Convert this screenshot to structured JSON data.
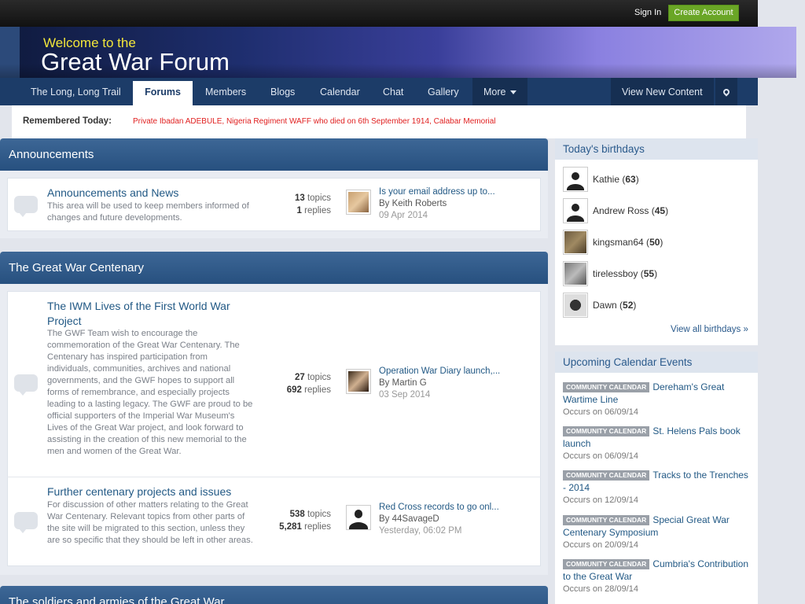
{
  "topbar": {
    "sign_in": "Sign In",
    "create_account": "Create Account"
  },
  "banner": {
    "welcome": "Welcome to the",
    "title": "Great War Forum"
  },
  "nav": {
    "items": [
      "The Long, Long Trail",
      "Forums",
      "Members",
      "Blogs",
      "Calendar",
      "Chat",
      "Gallery",
      "More"
    ],
    "view_new": "View New Content"
  },
  "remembered": {
    "label": "Remembered Today:",
    "message": "Private Ibadan ADEBULE, Nigeria Regiment WAFF who died on 6th September 1914, Calabar Memorial"
  },
  "categories": [
    {
      "title": "Announcements",
      "boards": [
        {
          "name": "Announcements and News",
          "description": "This area will be used to keep members informed of changes and future developments.",
          "topics": "13",
          "topics_label": "topics",
          "replies": "1",
          "replies_label": "replies",
          "last_title": "Is your email address up to...",
          "last_by": "By Keith Roberts",
          "last_date": "09 Apr 2014"
        }
      ]
    },
    {
      "title": "The Great War Centenary",
      "boards": [
        {
          "name": "The IWM Lives of the First World War Project",
          "description": "The GWF Team wish to encourage the commemoration of the Great War Centenary. The Centenary has inspired participation from individuals, communities, archives and national governments, and the GWF hopes to support all forms of remembrance, and especially projects leading to a lasting legacy. The GWF are proud to be official supporters of the Imperial War Museum's Lives of the Great War project, and look forward to assisting in the creation of this new memorial to the men and women of the Great War.",
          "topics": "27",
          "topics_label": "topics",
          "replies": "692",
          "replies_label": "replies",
          "last_title": "Operation War Diary launch,...",
          "last_by": "By Martin G",
          "last_date": "03 Sep 2014"
        },
        {
          "name": "Further centenary projects and issues",
          "description": "For discussion of other matters relating to the Great War Centenary. Relevant topics from other parts of the site will be migrated to this section, unless they are so specific that they should be left in other areas.",
          "topics": "538",
          "topics_label": "topics",
          "replies": "5,281",
          "replies_label": "replies",
          "last_title": "Red Cross records to go onl...",
          "last_by": "By 44SavageD",
          "last_date": "Yesterday, 06:02 PM"
        }
      ]
    },
    {
      "title": "The soldiers and armies of the Great War"
    }
  ],
  "birthdays": {
    "title": "Today's birthdays",
    "people": [
      {
        "name": "Kathie",
        "age": "63"
      },
      {
        "name": "Andrew Ross",
        "age": "45"
      },
      {
        "name": "kingsman64",
        "age": "50"
      },
      {
        "name": "tirelessboy",
        "age": "55"
      },
      {
        "name": "Dawn",
        "age": "52"
      }
    ],
    "view_all": "View all birthdays »"
  },
  "calendar": {
    "title": "Upcoming Calendar Events",
    "tag": "COMMUNITY CALENDAR",
    "events": [
      {
        "title": "Dereham's Great Wartime Line",
        "occurs": "Occurs on 06/09/14"
      },
      {
        "title": "St. Helens Pals book launch",
        "occurs": "Occurs on 06/09/14"
      },
      {
        "title": "Tracks to the Trenches - 2014",
        "occurs": "Occurs on 12/09/14"
      },
      {
        "title": "Special Great War Centenary Symposium",
        "occurs": "Occurs on 20/09/14"
      },
      {
        "title": "Cumbria's Contribution to the Great War",
        "occurs": "Occurs on 28/09/14"
      }
    ]
  }
}
